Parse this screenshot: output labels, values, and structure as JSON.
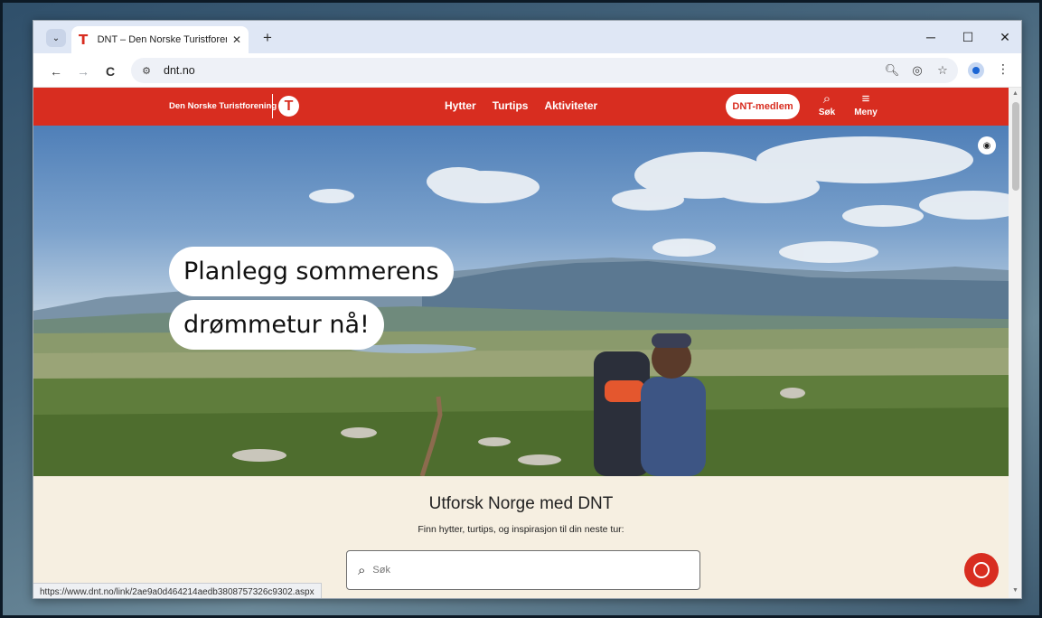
{
  "browser": {
    "tab": {
      "title": "DNT – Den Norske Turistforening",
      "favicon": "T",
      "close": "✕"
    },
    "new_tab": "+",
    "window_controls": {
      "minimize": "─",
      "maximize": "☐",
      "close": "✕"
    },
    "nav": {
      "back": "←",
      "forward": "→",
      "reload": "C"
    },
    "url": "dnt.no",
    "status_url": "https://www.dnt.no/link/2ae9a0d464214aedb3808757326c9302.aspx"
  },
  "header": {
    "brand": "Den Norske Turistforening",
    "logo_letter": "T",
    "nav": [
      "Hytter",
      "Turtips",
      "Aktiviteter"
    ],
    "member_button": "DNT-medlem",
    "search_label": "Søk",
    "menu_label": "Meny"
  },
  "hero": {
    "headline_line1": "Planlegg sommerens",
    "headline_line2": "drømmetur nå!"
  },
  "explore": {
    "title": "Utforsk Norge med DNT",
    "subtitle": "Finn hytter, turtips, og inspirasjon til din neste tur:",
    "search_placeholder": "Søk"
  },
  "icons": {
    "tab_search": "chevron-down-icon",
    "site_info": "tune-icon",
    "zoom": "zoom-icon",
    "eye_off": "eye-off-icon",
    "bookmark": "star-icon",
    "profile": "profile-icon",
    "menu": "kebab-icon",
    "camera": "camera-icon",
    "chat": "chat-icon"
  },
  "colors": {
    "brand_red": "#d82d20",
    "page_bg": "#f6efe1",
    "tabstrip": "#dfe7f5"
  }
}
